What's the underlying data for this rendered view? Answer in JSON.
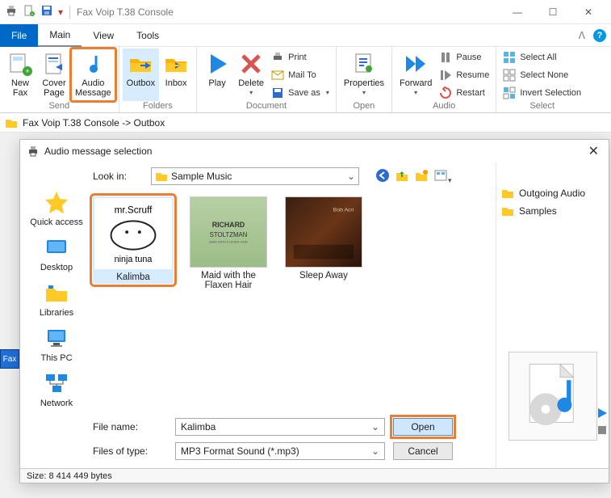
{
  "titlebar": {
    "app_title": "Fax Voip T.38 Console"
  },
  "menubar": {
    "file": "File",
    "main": "Main",
    "view": "View",
    "tools": "Tools"
  },
  "ribbon": {
    "send": {
      "label": "Send",
      "new_fax": "New\nFax",
      "cover_page": "Cover\nPage",
      "audio_message": "Audio\nMessage"
    },
    "folders": {
      "label": "Folders",
      "outbox": "Outbox",
      "inbox": "Inbox"
    },
    "document": {
      "label": "Document",
      "play": "Play",
      "delete": "Delete",
      "print": "Print",
      "mail_to": "Mail To",
      "save_as": "Save as"
    },
    "open": {
      "label": "Open",
      "properties": "Properties"
    },
    "audio": {
      "label": "Audio",
      "forward": "Forward",
      "pause": "Pause",
      "resume": "Resume",
      "restart": "Restart"
    },
    "select": {
      "label": "Select",
      "all": "Select All",
      "none": "Select None",
      "invert": "Invert Selection"
    }
  },
  "breadcrumb": {
    "text": "Fax Voip T.38 Console -> Outbox"
  },
  "dialog": {
    "title": "Audio message selection",
    "lookin_label": "Look in:",
    "lookin_value": "Sample Music",
    "places": {
      "quick": "Quick access",
      "desktop": "Desktop",
      "libraries": "Libraries",
      "thispc": "This PC",
      "network": "Network"
    },
    "files": [
      {
        "name": "Kalimba",
        "selected": true
      },
      {
        "name": "Maid with the Flaxen Hair",
        "selected": false
      },
      {
        "name": "Sleep Away",
        "selected": false
      }
    ],
    "filename_label": "File name:",
    "filename_value": "Kalimba",
    "filetype_label": "Files of type:",
    "filetype_value": "MP3 Format Sound (*.mp3)",
    "open_btn": "Open",
    "cancel_btn": "Cancel",
    "right": {
      "outgoing": "Outgoing Audio",
      "samples": "Samples"
    }
  },
  "statusbar": {
    "size": "Size: 8 414 449 bytes"
  },
  "taskbar": {
    "pinned": "Fax"
  }
}
